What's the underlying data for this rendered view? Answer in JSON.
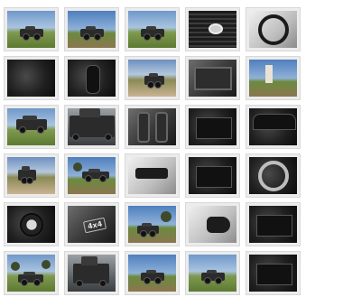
{
  "gallery": {
    "rows": 6,
    "columns": 5,
    "thumbnails": [
      {
        "subject": "truck-on-field",
        "bg": "bg-field"
      },
      {
        "subject": "truck-on-field",
        "bg": "bg-field2"
      },
      {
        "subject": "truck-on-field",
        "bg": "bg-field"
      },
      {
        "subject": "front-grille",
        "bg": "bg-dark"
      },
      {
        "subject": "interior-dashboard",
        "bg": "bg-light"
      },
      {
        "subject": "interior-dark",
        "bg": "bg-dark"
      },
      {
        "subject": "gear-lever",
        "bg": "bg-dark"
      },
      {
        "subject": "truck-on-dirt-road",
        "bg": "bg-dirt"
      },
      {
        "subject": "door-panel",
        "bg": "bg-grey"
      },
      {
        "subject": "water-tower",
        "bg": "bg-field2"
      },
      {
        "subject": "truck-bed-cover",
        "bg": "bg-field"
      },
      {
        "subject": "truck-side-garage",
        "bg": "bg-garage"
      },
      {
        "subject": "seats",
        "bg": "bg-grey"
      },
      {
        "subject": "control-panel",
        "bg": "bg-dark"
      },
      {
        "subject": "dashboard-gauges",
        "bg": "bg-dark"
      },
      {
        "subject": "truck-front-dirt",
        "bg": "bg-dirt"
      },
      {
        "subject": "truck-side-field",
        "bg": "bg-field2"
      },
      {
        "subject": "rearview-mirror",
        "bg": "bg-light"
      },
      {
        "subject": "center-console",
        "bg": "bg-dark"
      },
      {
        "subject": "steering-wheel",
        "bg": "bg-dark"
      },
      {
        "subject": "wheel-rim",
        "bg": "bg-dark"
      },
      {
        "subject": "4x4-badge",
        "bg": "bg-grey"
      },
      {
        "subject": "truck-with-tree",
        "bg": "bg-field2"
      },
      {
        "subject": "side-mirror",
        "bg": "bg-light"
      },
      {
        "subject": "switch-panel",
        "bg": "bg-dark"
      },
      {
        "subject": "truck-field-trees",
        "bg": "bg-field"
      },
      {
        "subject": "open-tailgate",
        "bg": "bg-garage"
      },
      {
        "subject": "truck-on-field",
        "bg": "bg-field2"
      },
      {
        "subject": "truck-on-field",
        "bg": "bg-field"
      },
      {
        "subject": "dashboard-center",
        "bg": "bg-dark"
      }
    ]
  }
}
